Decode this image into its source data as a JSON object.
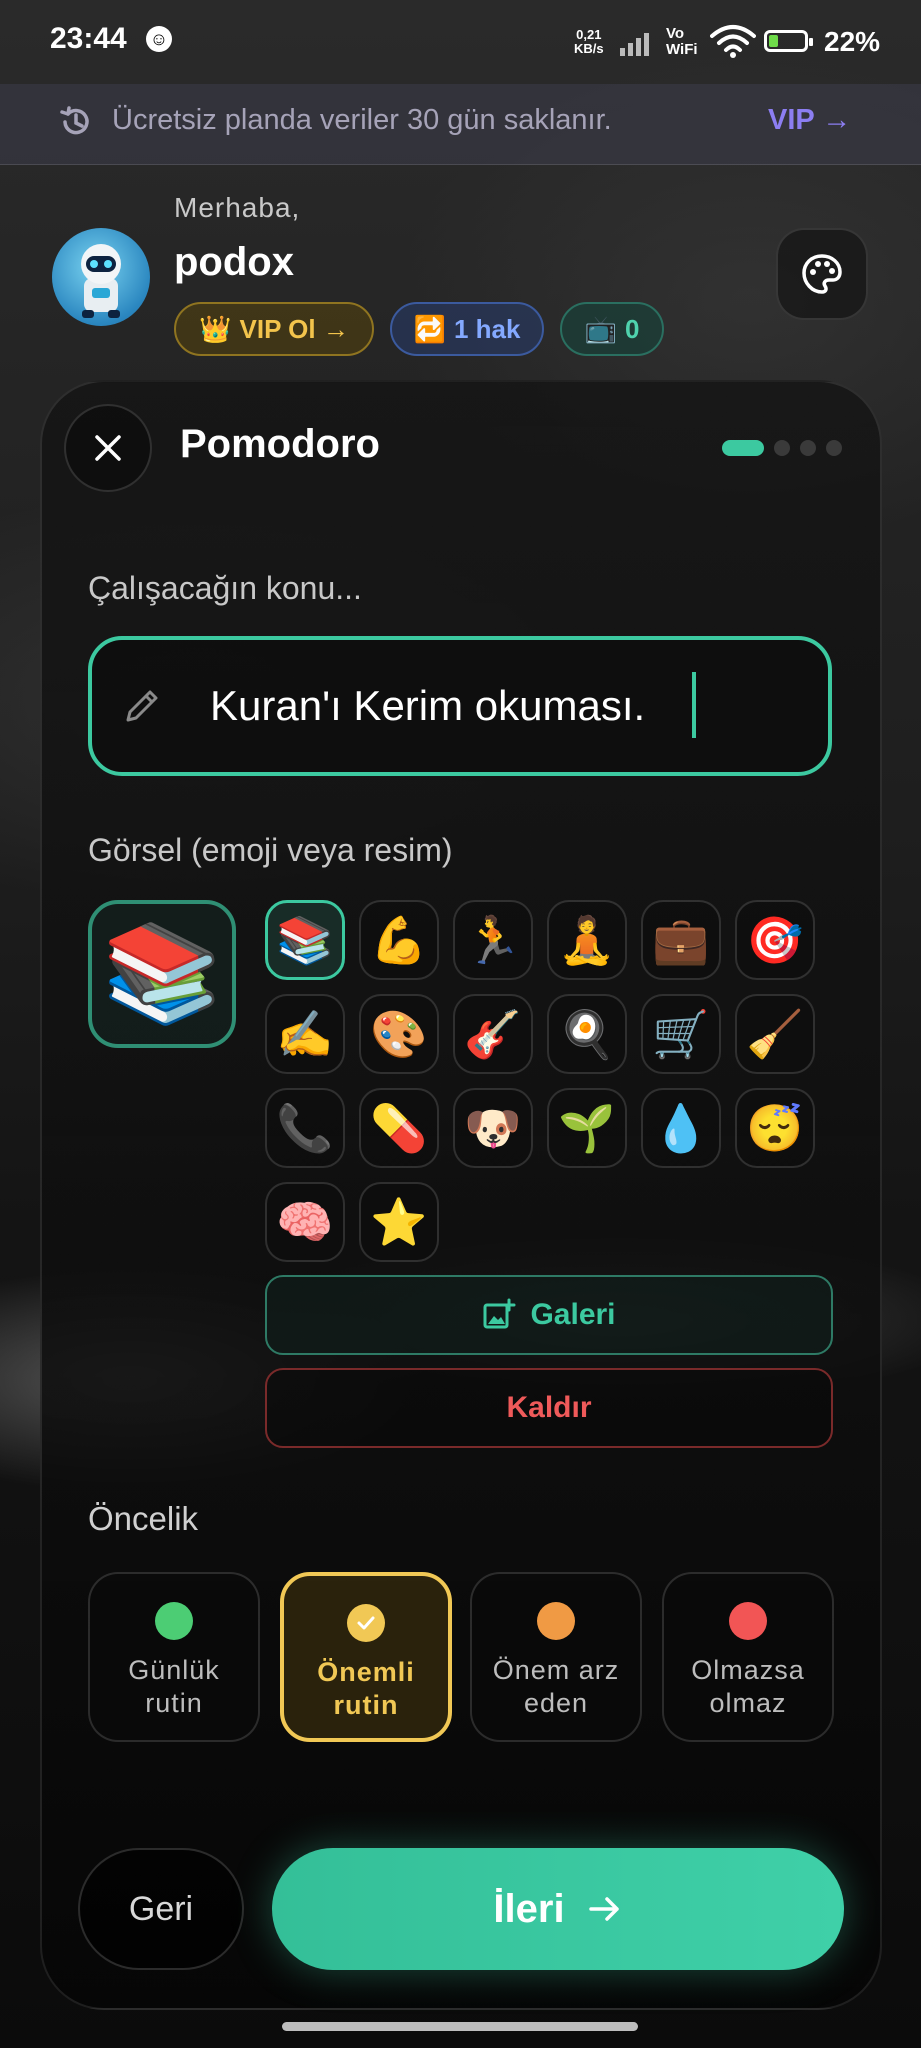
{
  "status_bar": {
    "time": "23:44",
    "speed_value": "0,21",
    "speed_unit": "KB/s",
    "vowifi_top": "Vo",
    "vowifi_bottom": "WiFi",
    "battery": "22%"
  },
  "banner": {
    "text": "Ücretsiz planda veriler 30 gün saklanır.",
    "vip_link": "VIP →"
  },
  "profile": {
    "greeting": "Merhaba,",
    "username": "podox",
    "vip_pill": "VIP Ol →",
    "hak_pill": "1 hak",
    "tv_pill": "0"
  },
  "dialog": {
    "title": "Pomodoro",
    "step_current": 1,
    "step_total": 4,
    "topic_label": "Çalışacağın konu...",
    "topic_value": "Kuran'ı Kerim okuması.",
    "visual_label": "Görsel (emoji veya resim)",
    "selected_emoji": "📚",
    "emojis": [
      {
        "char": "📚",
        "name": "books-emoji"
      },
      {
        "char": "💪",
        "name": "muscle-emoji"
      },
      {
        "char": "🏃",
        "name": "runner-emoji"
      },
      {
        "char": "🧘",
        "name": "meditation-emoji"
      },
      {
        "char": "💼",
        "name": "briefcase-emoji"
      },
      {
        "char": "🎯",
        "name": "target-emoji"
      },
      {
        "char": "✍️",
        "name": "writing-emoji"
      },
      {
        "char": "🎨",
        "name": "palette-emoji"
      },
      {
        "char": "🎸",
        "name": "guitar-emoji"
      },
      {
        "char": "🍳",
        "name": "cooking-emoji"
      },
      {
        "char": "🛒",
        "name": "cart-emoji"
      },
      {
        "char": "🧹",
        "name": "broom-emoji"
      },
      {
        "char": "📞",
        "name": "phone-emoji"
      },
      {
        "char": "💊",
        "name": "pill-emoji"
      },
      {
        "char": "🐶",
        "name": "dog-emoji"
      },
      {
        "char": "🌱",
        "name": "seedling-emoji"
      },
      {
        "char": "💧",
        "name": "droplet-emoji"
      },
      {
        "char": "😴",
        "name": "sleeping-emoji"
      },
      {
        "char": "🧠",
        "name": "brain-emoji"
      },
      {
        "char": "⭐",
        "name": "star-emoji"
      }
    ],
    "gallery_button": "Galeri",
    "remove_button": "Kaldır",
    "priority_label": "Öncelik",
    "priorities": [
      {
        "line1": "Günlük",
        "line2": "rutin",
        "color": "#4ccd74",
        "selected": false
      },
      {
        "line1": "Önemli",
        "line2": "rutin",
        "color": "#f1c855",
        "selected": true
      },
      {
        "line1": "Önem arz",
        "line2": "eden",
        "color": "#f09a44",
        "selected": false
      },
      {
        "line1": "Olmazsa",
        "line2": "olmaz",
        "color": "#f25555",
        "selected": false
      }
    ],
    "back_button": "Geri",
    "next_button": "İleri"
  },
  "colors": {
    "accent": "#3cc9a0",
    "vip": "#8c7ef2",
    "danger": "#ef5a5a",
    "priority_selected": "#f1c855"
  }
}
